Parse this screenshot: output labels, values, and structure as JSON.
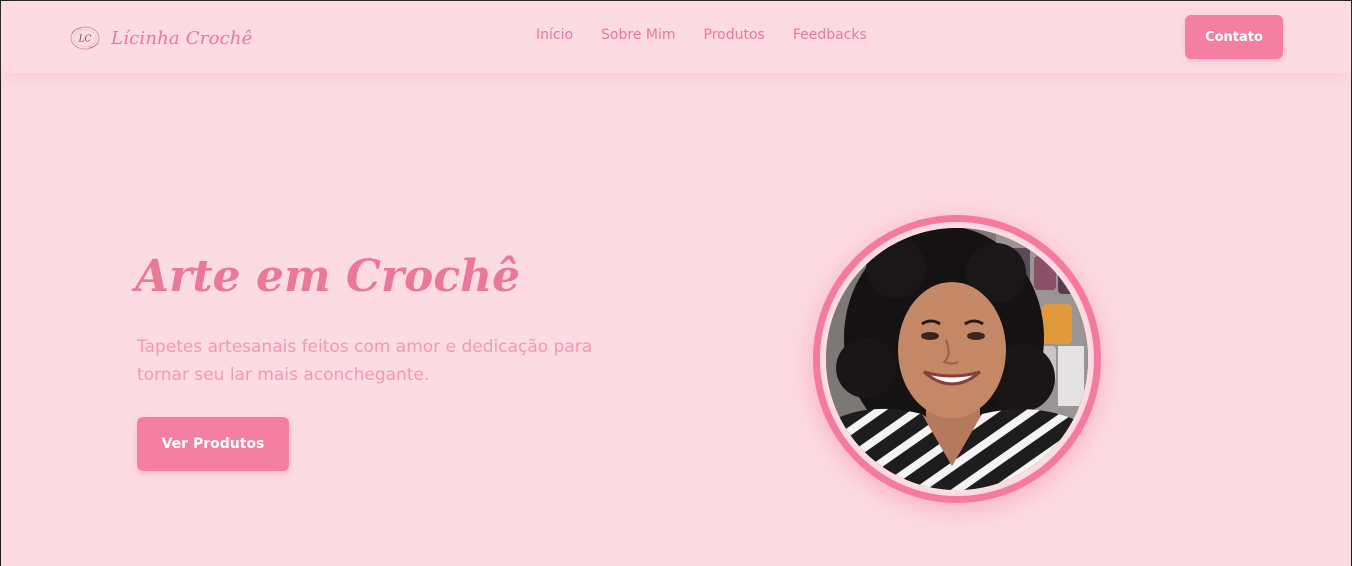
{
  "brand": {
    "name": "Lícinha Crochê",
    "logo_text": "LC",
    "logo_icon": "lc-monogram-icon"
  },
  "nav": {
    "items": [
      {
        "label": "Início"
      },
      {
        "label": "Sobre Mim"
      },
      {
        "label": "Produtos"
      },
      {
        "label": "Feedbacks"
      }
    ],
    "cta_label": "Contato"
  },
  "hero": {
    "title": "Arte em Crochê",
    "subtitle": "Tapetes artesanais feitos com amor e dedicação para tornar seu lar mais aconchegante.",
    "button_label": "Ver Produtos"
  },
  "colors": {
    "background": "#fddbe3",
    "accent": "#f57fa0",
    "text_pink": "#e97896"
  }
}
